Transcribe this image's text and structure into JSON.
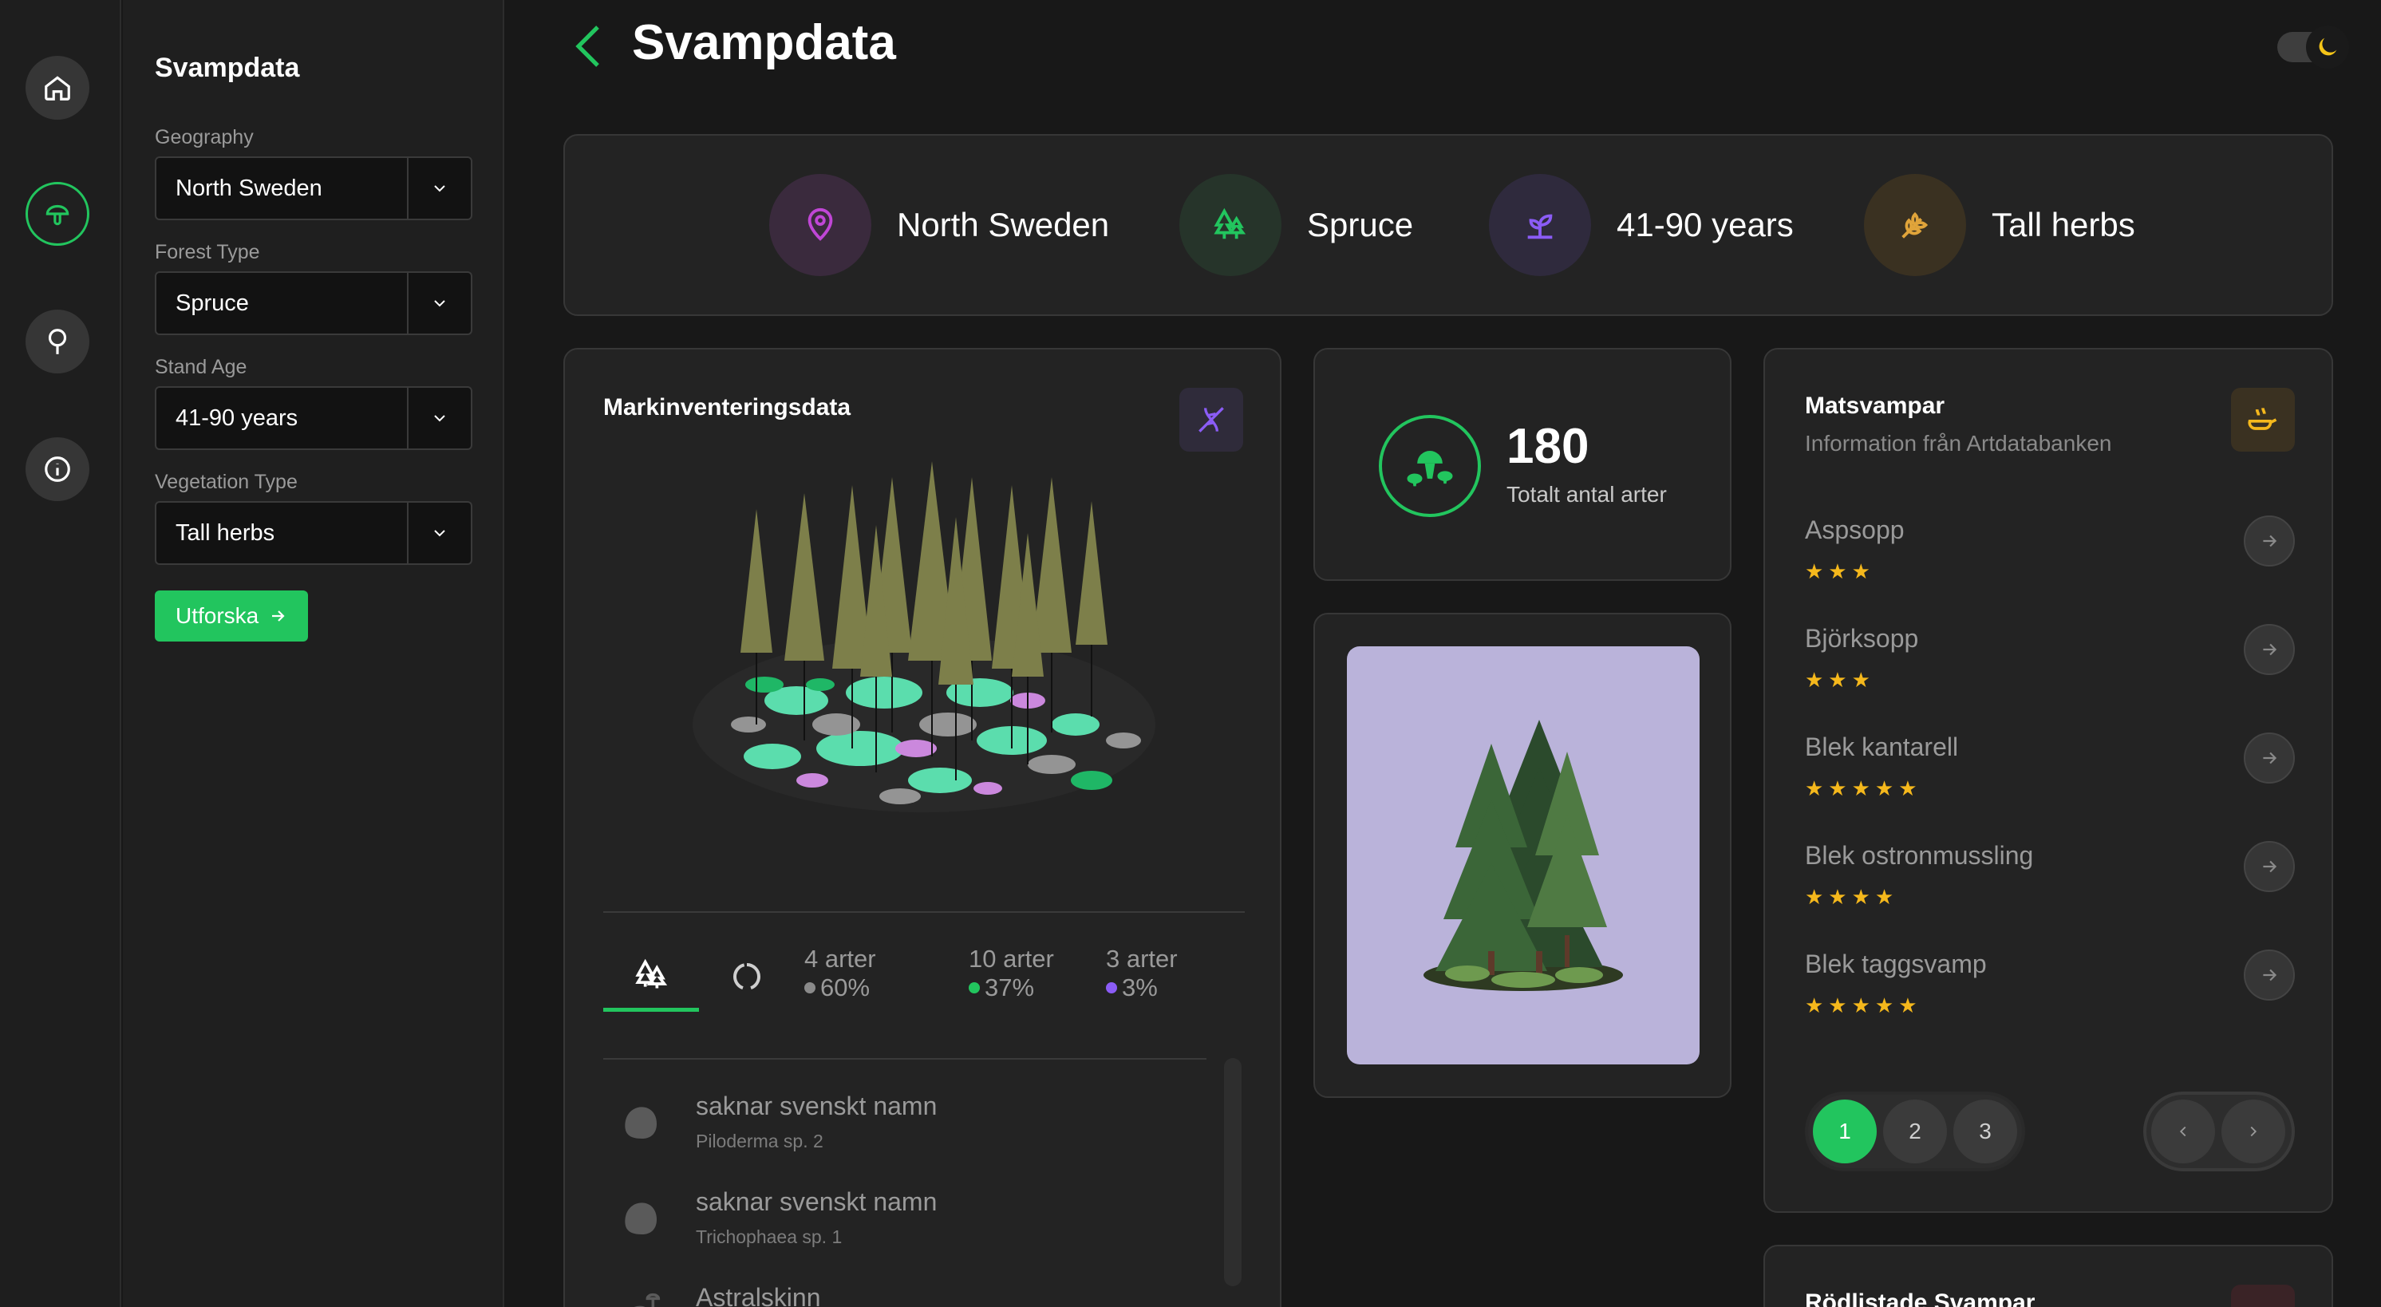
{
  "header": {
    "title": "Svampdata"
  },
  "sidebar": {
    "title": "Svampdata",
    "filters": [
      {
        "label": "Geography",
        "value": "North Sweden"
      },
      {
        "label": "Forest Type",
        "value": "Spruce"
      },
      {
        "label": "Stand Age",
        "value": "41-90 years"
      },
      {
        "label": "Vegetation Type",
        "value": "Tall herbs"
      }
    ],
    "explore_label": "Utforska"
  },
  "summary": {
    "chips": [
      {
        "label": "North Sweden",
        "icon": "location-pin-icon",
        "color": "#c046d6"
      },
      {
        "label": "Spruce",
        "icon": "trees-icon",
        "color": "#22c55e"
      },
      {
        "label": "41-90 years",
        "icon": "sprout-icon",
        "color": "#8b5cf6"
      },
      {
        "label": "Tall herbs",
        "icon": "wheat-icon",
        "color": "#e0a43a"
      }
    ]
  },
  "inventory": {
    "title": "Markinventeringsdata",
    "stats": [
      {
        "count": "4 arter",
        "percent": "60%",
        "color": "#8a8a8a"
      },
      {
        "count": "10 arter",
        "percent": "37%",
        "color": "#22c55e"
      },
      {
        "count": "3 arter",
        "percent": "3%",
        "color": "#8b5cf6"
      }
    ],
    "species": [
      {
        "common": "saknar svenskt namn",
        "latin": "Piloderma sp. 2"
      },
      {
        "common": "saknar svenskt namn",
        "latin": "Trichophaea sp. 1"
      },
      {
        "common": "Astralskinn",
        "latin": ""
      }
    ]
  },
  "total": {
    "number": "180",
    "label": "Totalt antal arter"
  },
  "mats": {
    "title": "Matsvampar",
    "subtitle": "Information från Artdatabanken",
    "items": [
      {
        "name": "Aspsopp",
        "rating": 3,
        "stars": "★★★"
      },
      {
        "name": "Björksopp",
        "rating": 3,
        "stars": "★★★"
      },
      {
        "name": "Blek kantarell",
        "rating": 5,
        "stars": "★★★★★"
      },
      {
        "name": "Blek ostronmussling",
        "rating": 4,
        "stars": "★★★★"
      },
      {
        "name": "Blek taggsvamp",
        "rating": 5,
        "stars": "★★★★★"
      }
    ],
    "pages": [
      "1",
      "2",
      "3"
    ]
  },
  "redlisted": {
    "title": "Rödlistade Svampar"
  },
  "colors": {
    "accent": "#22c55e",
    "star": "#f5b81c",
    "background": "#181818"
  }
}
